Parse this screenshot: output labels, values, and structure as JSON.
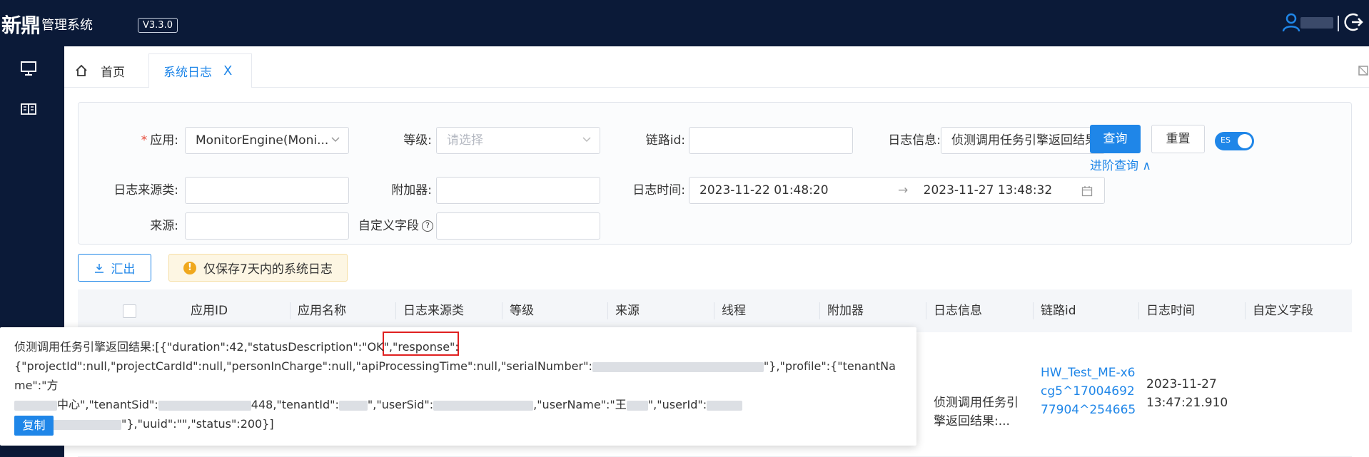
{
  "header": {
    "logo_brand": "新鼎",
    "logo_suffix": "管理系统",
    "version": "V3.3.0"
  },
  "tabs": [
    {
      "label": "首页"
    },
    {
      "label": "系统日志",
      "close": "X"
    }
  ],
  "filters": {
    "app_label": "应用:",
    "app_value": "MonitorEngine(Moni...",
    "level_label": "等级:",
    "level_placeholder": "请选择",
    "trace_label": "链路id:",
    "trace_value": "",
    "loginfo_label": "日志信息:",
    "loginfo_value": "侦测调用任务引擎返回结果",
    "source_type_label": "日志来源类:",
    "appender_label": "附加器:",
    "logtime_label": "日志时间:",
    "time_start": "2023-11-22 01:48:20",
    "time_arrow": "→",
    "time_end": "2023-11-27 13:48:32",
    "origin_label": "来源:",
    "custom_label": "自定义字段",
    "help": "?"
  },
  "actions": {
    "query": "查询",
    "reset": "重置",
    "es_switch": "ES",
    "advanced": "进阶查询 ∧",
    "export": "汇出",
    "warning": "仅保存7天内的系统日志",
    "warning_icon": "!"
  },
  "table": {
    "columns": [
      "应用ID",
      "应用名称",
      "日志来源类",
      "等级",
      "来源",
      "线程",
      "附加器",
      "日志信息",
      "链路id",
      "日志时间",
      "自定义字段"
    ],
    "row": {
      "loginfo": "侦测调用任务引擎返回结果:...",
      "trace_id": "HW_Test_ME-x6cg5^1700469277904^254665",
      "time": "2023-11-27 13:47:21.910"
    }
  },
  "popup": {
    "line1_a": "侦测调用任务引擎返回结果:[{\"duration\":42,\"statusDescription\":\"OK\",",
    "line1_b": "\"response\":",
    "line2_a": "{\"projectId\":null,\"projectCardId\":null,\"personInCharge\":null,\"apiProcessingTime\":null,\"serialNumber\":",
    "line2_b": "\"},\"profile\":{\"tenantName\":\"方",
    "line3_a": "中心\",\"tenantSid\":",
    "line3_b": "448,\"tenantId\":",
    "line3_c": "\",\"userSid\":",
    "line3_d": ",\"userName\":\"王",
    "line3_e": "\",\"userId\":",
    "line4_a": "\"},\"uuid\":\"\",\"status\":200}]",
    "copy": "复制"
  },
  "colors": {
    "navbar": "#0b1a38",
    "primary": "#1f86e8",
    "highlight_box": "#e02020",
    "warning_bg": "#fdf6e3"
  }
}
